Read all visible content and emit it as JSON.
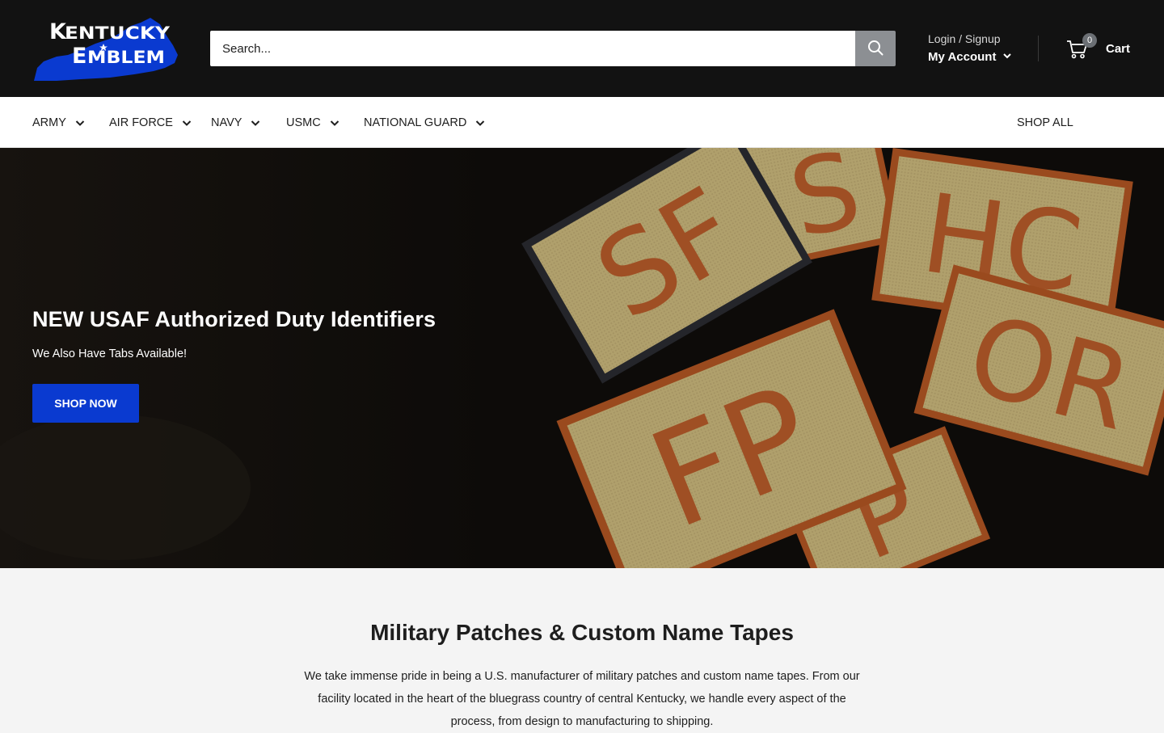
{
  "header": {
    "logo_text": "Kentucky Emblem",
    "search": {
      "placeholder": "Search..."
    },
    "account": {
      "login_label": "Login / Signup",
      "my_account_label": "My Account"
    },
    "cart": {
      "count": "0",
      "label": "Cart"
    }
  },
  "nav": {
    "items": [
      {
        "label": "Army"
      },
      {
        "label": "Air Force"
      },
      {
        "label": "Navy"
      },
      {
        "label": "USMC"
      },
      {
        "label": "National Guard"
      }
    ],
    "shop_all": "Shop All"
  },
  "hero": {
    "title": "NEW USAF Authorized Duty Identifiers",
    "subtitle": "We Also Have Tabs Available!",
    "button_label": "Shop now",
    "patch_letters": [
      "SF",
      "S",
      "HC",
      "OR",
      "FP",
      "P"
    ]
  },
  "intro": {
    "title": "Military Patches & Custom Name Tapes",
    "text": "We take immense pride in being a U.S. manufacturer of military patches and custom name tapes. From our facility located in the heart of the bluegrass country of central Kentucky, we handle every aspect of the process, from design to manufacturing to shipping."
  },
  "colors": {
    "header_bg": "#121212",
    "accent_blue": "#0a3ad0",
    "patch_tan": "#b4a26e",
    "patch_border": "#9a4a1e"
  }
}
